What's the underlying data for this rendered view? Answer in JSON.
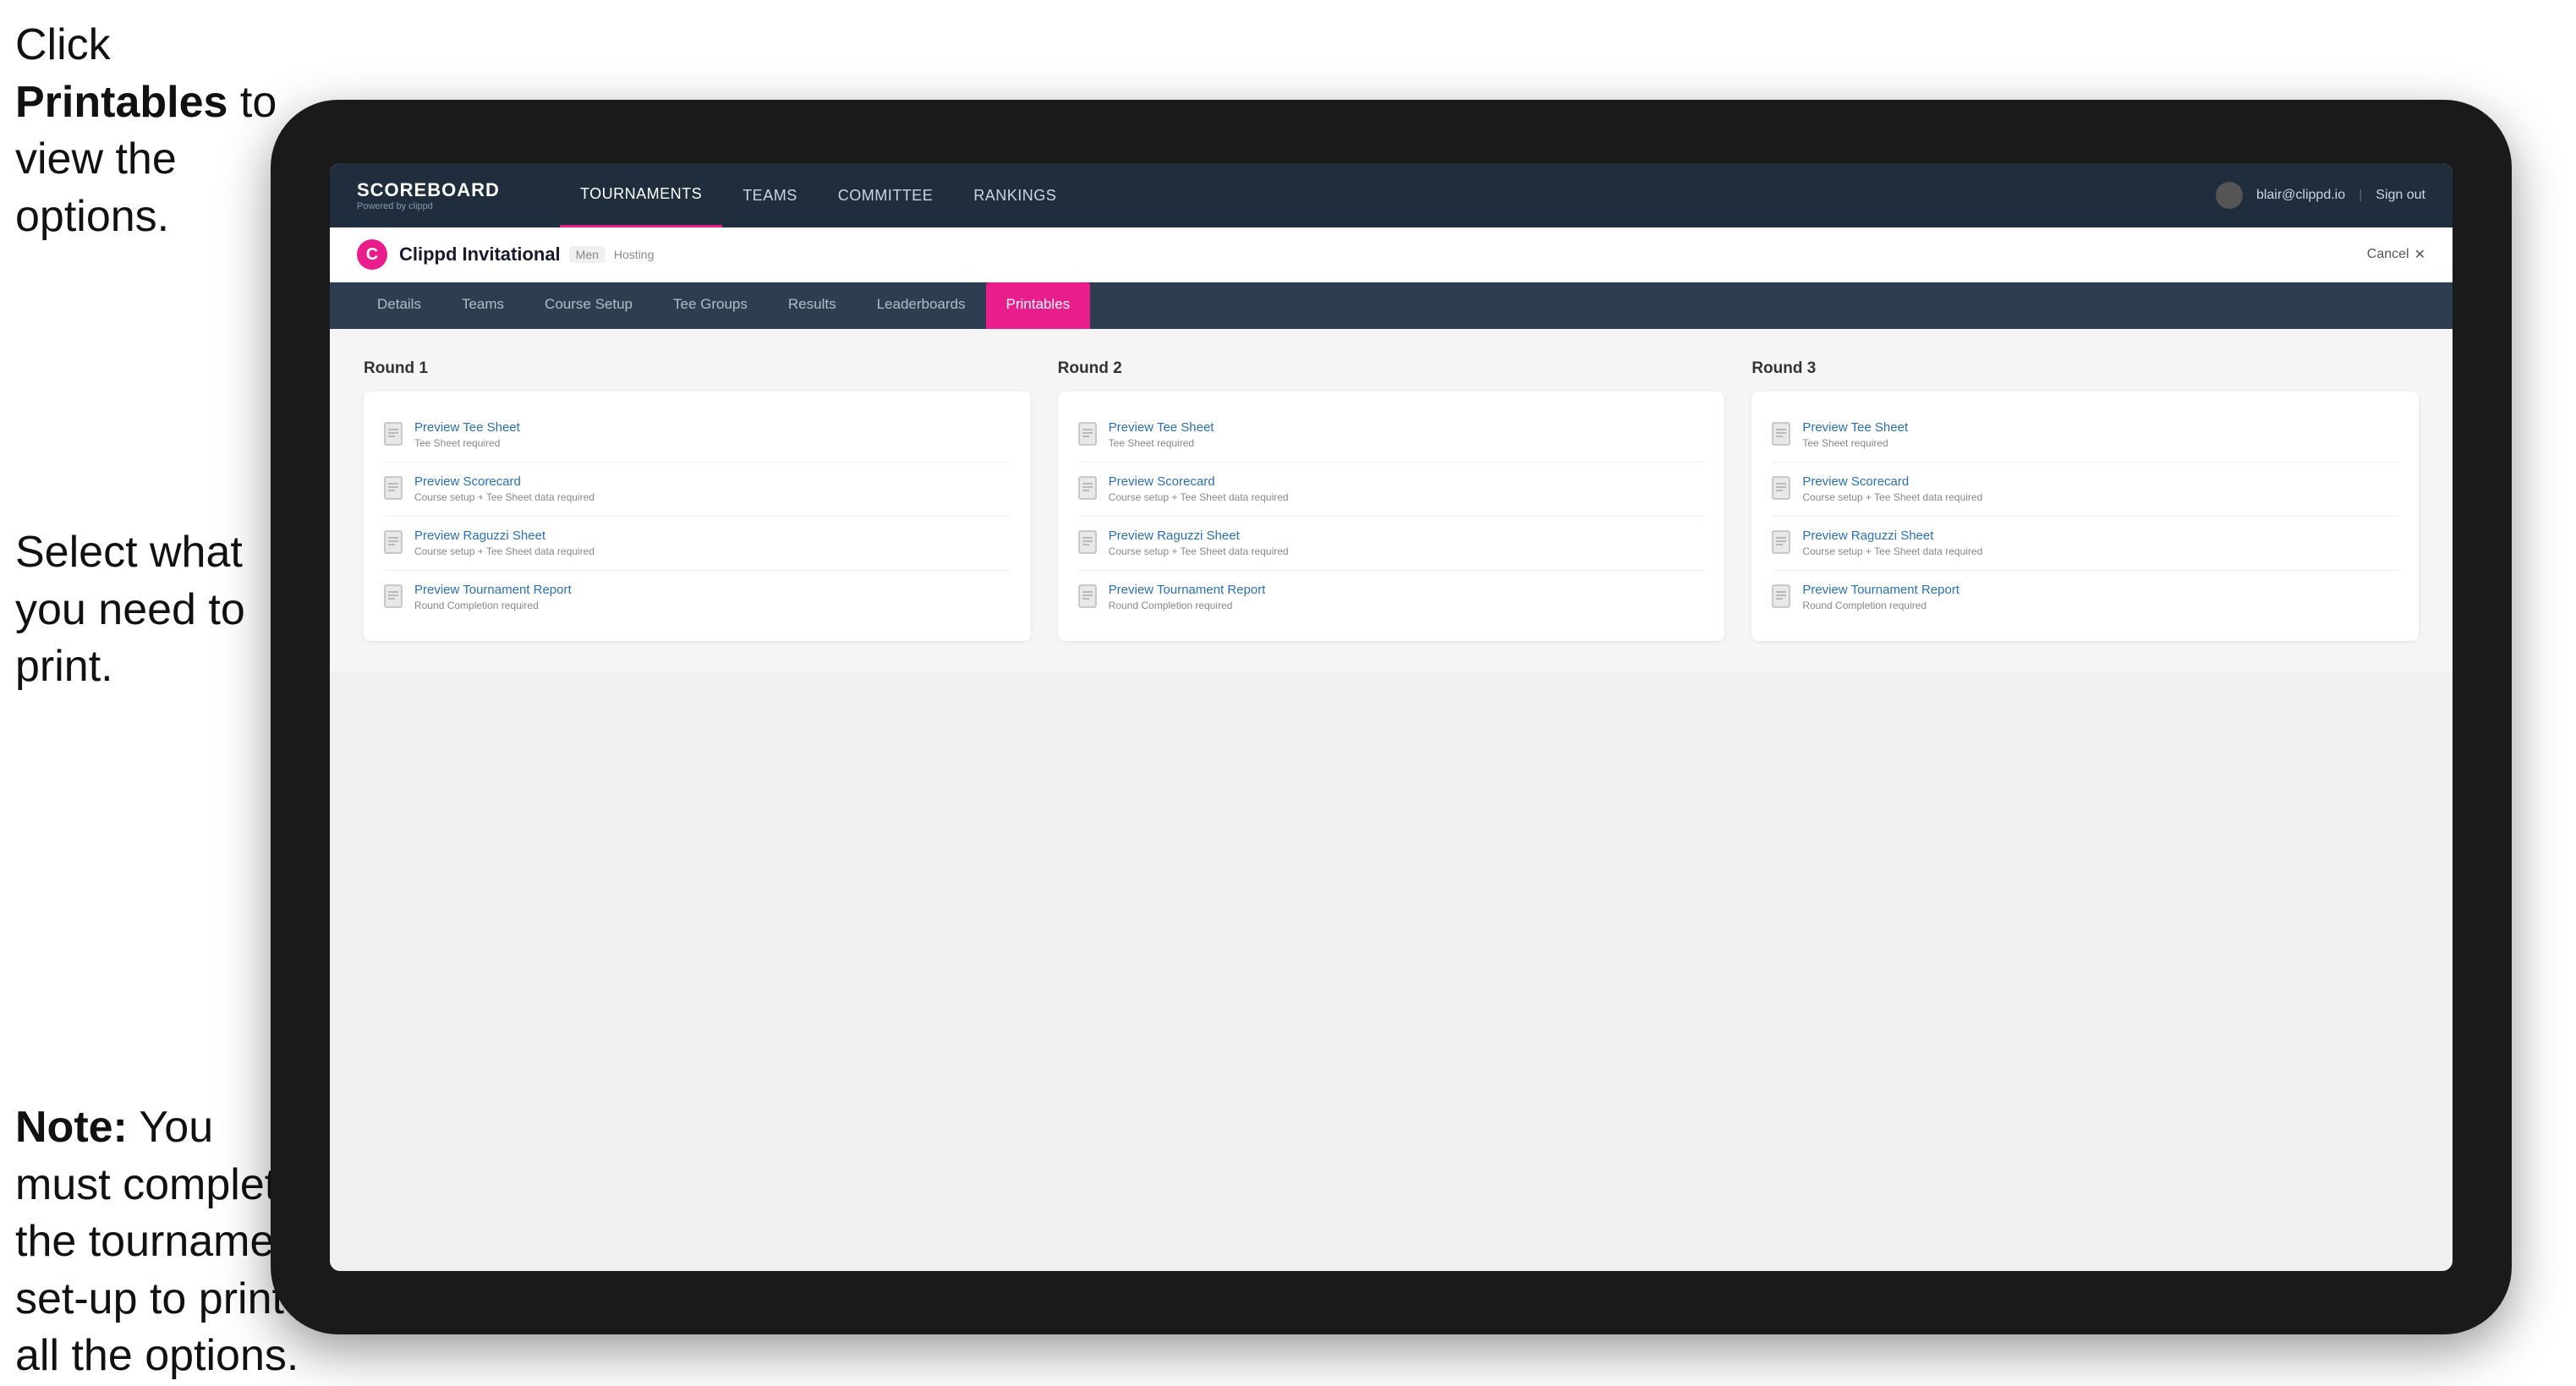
{
  "annotations": {
    "top": {
      "text_before": "Click ",
      "bold": "Printables",
      "text_after": " to view the options."
    },
    "middle": {
      "text": "Select what you need to print."
    },
    "bottom": {
      "bold": "Note:",
      "text_after": " You must complete the tournament set-up to print all the options."
    }
  },
  "topNav": {
    "logo": "SCOREBOARD",
    "logoSub": "Powered by clippd",
    "links": [
      "TOURNAMENTS",
      "TEAMS",
      "COMMITTEE",
      "RANKINGS"
    ],
    "activeLink": "TOURNAMENTS",
    "user": "blair@clippd.io",
    "signout": "Sign out"
  },
  "tournamentHeader": {
    "logoLetter": "C",
    "name": "Clippd Invitational",
    "tag": "Men",
    "status": "Hosting",
    "cancelLabel": "Cancel"
  },
  "subNav": {
    "tabs": [
      "Details",
      "Teams",
      "Course Setup",
      "Tee Groups",
      "Results",
      "Leaderboards",
      "Printables"
    ],
    "activeTab": "Printables"
  },
  "rounds": [
    {
      "title": "Round 1",
      "items": [
        {
          "title": "Preview Tee Sheet",
          "sub": "Tee Sheet required"
        },
        {
          "title": "Preview Scorecard",
          "sub": "Course setup + Tee Sheet data required"
        },
        {
          "title": "Preview Raguzzi Sheet",
          "sub": "Course setup + Tee Sheet data required"
        },
        {
          "title": "Preview Tournament Report",
          "sub": "Round Completion required"
        }
      ]
    },
    {
      "title": "Round 2",
      "items": [
        {
          "title": "Preview Tee Sheet",
          "sub": "Tee Sheet required"
        },
        {
          "title": "Preview Scorecard",
          "sub": "Course setup + Tee Sheet data required"
        },
        {
          "title": "Preview Raguzzi Sheet",
          "sub": "Course setup + Tee Sheet data required"
        },
        {
          "title": "Preview Tournament Report",
          "sub": "Round Completion required"
        }
      ]
    },
    {
      "title": "Round 3",
      "items": [
        {
          "title": "Preview Tee Sheet",
          "sub": "Tee Sheet required"
        },
        {
          "title": "Preview Scorecard",
          "sub": "Course setup + Tee Sheet data required"
        },
        {
          "title": "Preview Raguzzi Sheet",
          "sub": "Course setup + Tee Sheet data required"
        },
        {
          "title": "Preview Tournament Report",
          "sub": "Round Completion required"
        }
      ]
    }
  ]
}
